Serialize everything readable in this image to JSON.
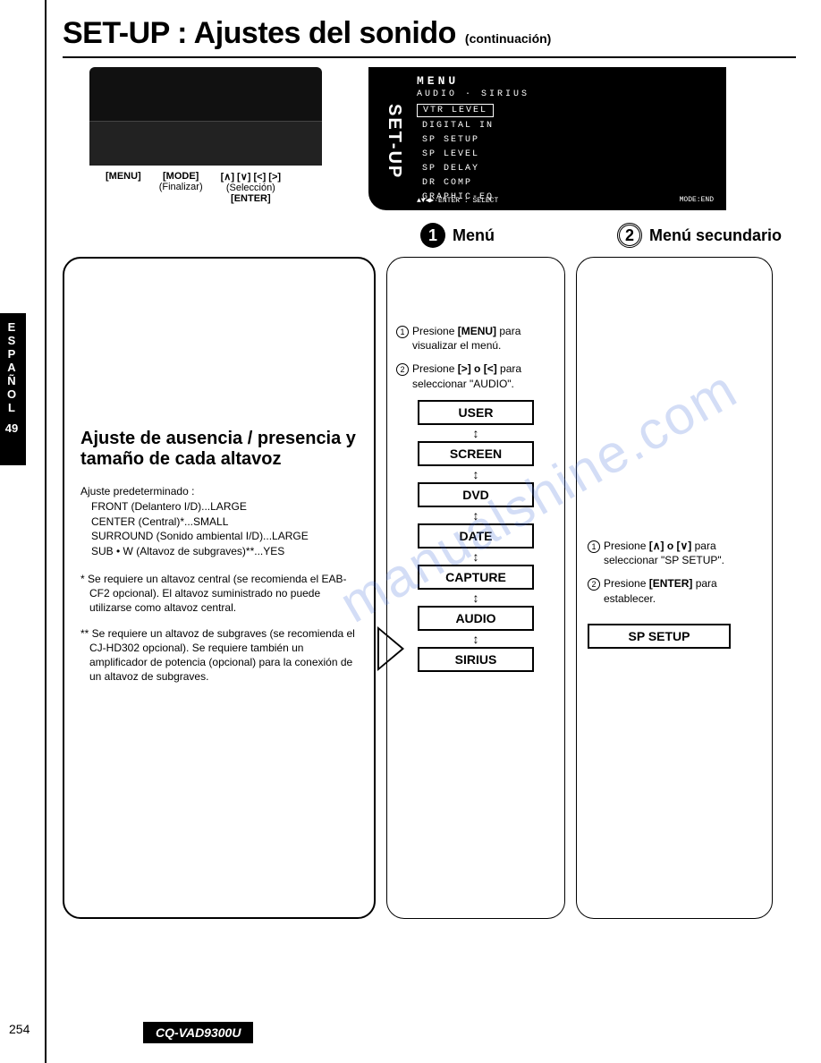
{
  "title": {
    "main": "SET-UP : Ajustes del sonido",
    "cont": "(continuación)"
  },
  "buttons": {
    "menu": "[MENU]",
    "mode": "[MODE]",
    "mode_sub": "(Finalizar)",
    "arrows": "[∧] [∨] [<] [>]",
    "arrows_sub": "(Selección)",
    "enter": "[ENTER]"
  },
  "screen": {
    "tab": "SET-UP",
    "menu": "MENU",
    "path": "AUDIO · SIRIUS",
    "items": [
      "VTR LEVEL",
      "DIGITAL IN",
      "SP SETUP",
      "SP LEVEL",
      "SP DELAY",
      "DR COMP",
      "GRAPHIC-EQ"
    ],
    "selected": 0,
    "foot_left": "▲▼◀▶·ENTER : SELECT",
    "foot_right": "MODE:END"
  },
  "steps": {
    "s1": "Menú",
    "s2": "Menú secundario"
  },
  "lang": {
    "letters": [
      "E",
      "S",
      "P",
      "A",
      "Ñ",
      "O",
      "L"
    ],
    "num": "49"
  },
  "left": {
    "heading": "Ajuste de ausencia / presencia y tamaño de cada altavoz",
    "preset_label": "Ajuste predeterminado :",
    "preset_lines": [
      "FRONT (Delantero I/D)...LARGE",
      "CENTER (Central)*...SMALL",
      "SURROUND (Sonido ambiental I/D)...LARGE",
      "SUB • W (Altavoz de subgraves)**...YES"
    ],
    "note1": "* Se requiere un altavoz central (se recomienda el EAB-CF2 opcional). El altavoz suministrado no puede utilizarse como altavoz central.",
    "note2": "** Se requiere un altavoz de subgraves (se recomienda el CJ-HD302 opcional). Se requiere también un amplificador de potencia (opcional) para la conexión de un altavoz de subgraves."
  },
  "mid": {
    "i1a": "Presione ",
    "i1b": "[MENU]",
    "i1c": " para visualizar el menú.",
    "i2a": "Presione ",
    "i2b": "[>] o [<]",
    "i2c": " para seleccionar \"AUDIO\".",
    "menu_items": [
      "USER",
      "SCREEN",
      "DVD",
      "DATE",
      "CAPTURE",
      "AUDIO",
      "SIRIUS"
    ]
  },
  "right": {
    "i1a": "Presione ",
    "i1b": "[∧] o [∨]",
    "i1c": " para seleccionar \"SP SETUP\".",
    "i2a": "Presione ",
    "i2b": "[ENTER]",
    "i2c": " para establecer.",
    "box": "SP SETUP"
  },
  "page_num": "254",
  "model": "CQ-VAD9300U",
  "watermark": "manualshine.com"
}
